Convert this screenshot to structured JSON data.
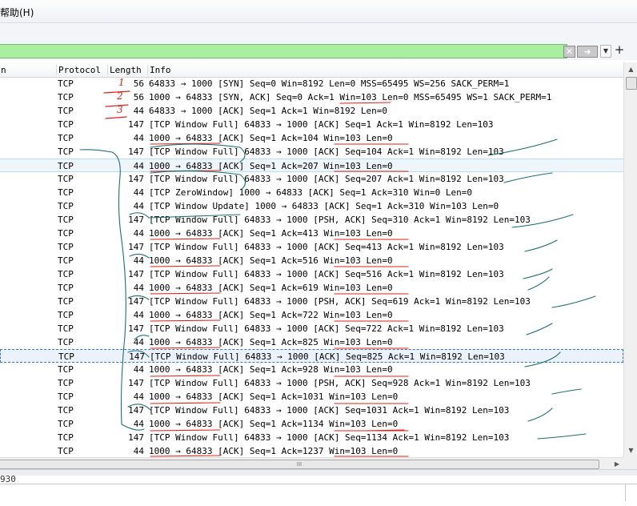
{
  "menu": {
    "help_label": "帮助(H)"
  },
  "filter": {
    "value": "",
    "bg_color": "#a8f0a0",
    "clear_icon": "clear-x-icon",
    "apply_icon": "apply-arrow-icon",
    "dropdown_icon": "chevron-down-icon",
    "add_label": "+"
  },
  "columns": {
    "first_partial": "n",
    "protocol": "Protocol",
    "length": "Length",
    "info": "Info"
  },
  "packets": [
    {
      "protocol": "TCP",
      "length": "56",
      "info": "64833 → 1000 [SYN] Seq=0 Win=8192 Len=0 MSS=65495 WS=256 SACK_PERM=1"
    },
    {
      "protocol": "TCP",
      "length": "56",
      "info": "1000 → 64833 [SYN, ACK] Seq=0 Ack=1 Win=103 Len=0 MSS=65495 WS=1 SACK_PERM=1"
    },
    {
      "protocol": "TCP",
      "length": "44",
      "info": "64833 → 1000 [ACK] Seq=1 Ack=1 Win=8192 Len=0"
    },
    {
      "protocol": "TCP",
      "length": "147",
      "info": "[TCP Window Full] 64833 → 1000 [ACK] Seq=1 Ack=1 Win=8192 Len=103"
    },
    {
      "protocol": "TCP",
      "length": "44",
      "info": "1000 → 64833 [ACK] Seq=1 Ack=104 Win=103 Len=0"
    },
    {
      "protocol": "TCP",
      "length": "147",
      "info": "[TCP Window Full] 64833 → 1000 [ACK] Seq=104 Ack=1 Win=8192 Len=103"
    },
    {
      "protocol": "TCP",
      "length": "44",
      "info": "1000 → 64833 [ACK] Seq=1 Ack=207 Win=103 Len=0"
    },
    {
      "protocol": "TCP",
      "length": "147",
      "info": "[TCP Window Full] 64833 → 1000 [ACK] Seq=207 Ack=1 Win=8192 Len=103"
    },
    {
      "protocol": "TCP",
      "length": "44",
      "info": "[TCP ZeroWindow] 1000 → 64833 [ACK] Seq=1 Ack=310 Win=0 Len=0"
    },
    {
      "protocol": "TCP",
      "length": "44",
      "info": "[TCP Window Update] 1000 → 64833 [ACK] Seq=1 Ack=310 Win=103 Len=0"
    },
    {
      "protocol": "TCP",
      "length": "147",
      "info": "[TCP Window Full] 64833 → 1000 [PSH, ACK] Seq=310 Ack=1 Win=8192 Len=103"
    },
    {
      "protocol": "TCP",
      "length": "44",
      "info": "1000 → 64833 [ACK] Seq=1 Ack=413 Win=103 Len=0"
    },
    {
      "protocol": "TCP",
      "length": "147",
      "info": "[TCP Window Full] 64833 → 1000 [ACK] Seq=413 Ack=1 Win=8192 Len=103"
    },
    {
      "protocol": "TCP",
      "length": "44",
      "info": "1000 → 64833 [ACK] Seq=1 Ack=516 Win=103 Len=0"
    },
    {
      "protocol": "TCP",
      "length": "147",
      "info": "[TCP Window Full] 64833 → 1000 [ACK] Seq=516 Ack=1 Win=8192 Len=103"
    },
    {
      "protocol": "TCP",
      "length": "44",
      "info": "1000 → 64833 [ACK] Seq=1 Ack=619 Win=103 Len=0"
    },
    {
      "protocol": "TCP",
      "length": "147",
      "info": "[TCP Window Full] 64833 → 1000 [PSH, ACK] Seq=619 Ack=1 Win=8192 Len=103"
    },
    {
      "protocol": "TCP",
      "length": "44",
      "info": "1000 → 64833 [ACK] Seq=1 Ack=722 Win=103 Len=0"
    },
    {
      "protocol": "TCP",
      "length": "147",
      "info": "[TCP Window Full] 64833 → 1000 [ACK] Seq=722 Ack=1 Win=8192 Len=103"
    },
    {
      "protocol": "TCP",
      "length": "44",
      "info": "1000 → 64833 [ACK] Seq=1 Ack=825 Win=103 Len=0"
    },
    {
      "protocol": "TCP",
      "length": "147",
      "info": "[TCP Window Full] 64833 → 1000 [ACK] Seq=825 Ack=1 Win=8192 Len=103"
    },
    {
      "protocol": "TCP",
      "length": "44",
      "info": "1000 → 64833 [ACK] Seq=1 Ack=928 Win=103 Len=0"
    },
    {
      "protocol": "TCP",
      "length": "147",
      "info": "[TCP Window Full] 64833 → 1000 [PSH, ACK] Seq=928 Ack=1 Win=8192 Len=103"
    },
    {
      "protocol": "TCP",
      "length": "44",
      "info": "1000 → 64833 [ACK] Seq=1 Ack=1031 Win=103 Len=0"
    },
    {
      "protocol": "TCP",
      "length": "147",
      "info": "[TCP Window Full] 64833 → 1000 [ACK] Seq=1031 Ack=1 Win=8192 Len=103"
    },
    {
      "protocol": "TCP",
      "length": "44",
      "info": "1000 → 64833 [ACK] Seq=1 Ack=1134 Win=103 Len=0"
    },
    {
      "protocol": "TCP",
      "length": "147",
      "info": "[TCP Window Full] 64833 → 1000 [ACK] Seq=1134 Ack=1 Win=8192 Len=103"
    },
    {
      "protocol": "TCP",
      "length": "44",
      "info": "1000 → 64833 [ACK] Seq=1 Ack=1237 Win=103 Len=0"
    }
  ],
  "selection": {
    "hover_row": 6,
    "focus_row": 20
  },
  "scroll": {
    "up_icon": "scroll-up-arrow-icon",
    "down_icon": "scroll-down-arrow-icon",
    "right_icon": "scroll-right-arrow-icon",
    "grip_label": "III"
  },
  "detail": {
    "partial_text": "930"
  },
  "annotation_colors": {
    "red": "#e0201a",
    "blue": "#1f6e70"
  },
  "annotation_marks": [
    "1",
    "2",
    "3"
  ]
}
